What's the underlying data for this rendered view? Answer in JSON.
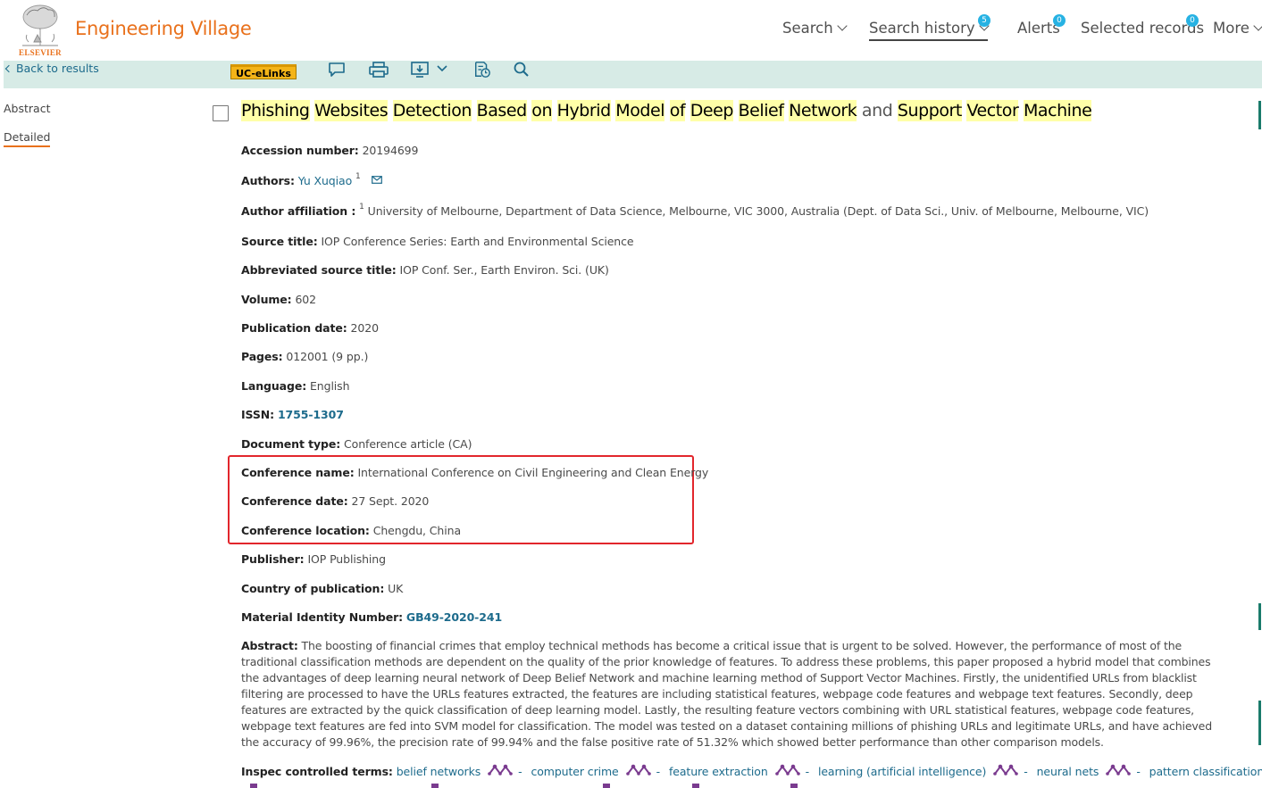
{
  "brand": {
    "logo_text": "ELSEVIER",
    "name": "Engineering Village"
  },
  "topnav": {
    "search": "Search",
    "search_history": "Search history",
    "search_history_badge": "5",
    "alerts": "Alerts",
    "alerts_badge": "0",
    "selected_records": "Selected records",
    "selected_records_badge": "0",
    "more": "More"
  },
  "toolbar": {
    "back_label": "Back to results",
    "uc_elinks": "UC-eLinks",
    "icons": [
      "comment-icon",
      "print-icon",
      "download-icon",
      "folder-save-icon",
      "search-icon"
    ]
  },
  "sidenav": {
    "abstract": "Abstract",
    "detailed": "Detailed"
  },
  "record": {
    "title_words": [
      {
        "text": "Phishing",
        "hl": true
      },
      {
        "text": "Websites",
        "hl": true
      },
      {
        "text": "Detection",
        "hl": true
      },
      {
        "text": "Based",
        "hl": true
      },
      {
        "text": "on",
        "hl": true
      },
      {
        "text": "Hybrid",
        "hl": true
      },
      {
        "text": "Model",
        "hl": true
      },
      {
        "text": "of",
        "hl": true
      },
      {
        "text": "Deep",
        "hl": true
      },
      {
        "text": "Belief",
        "hl": true
      },
      {
        "text": "Network",
        "hl": true
      },
      {
        "text": "and",
        "hl": false
      },
      {
        "text": "Support",
        "hl": true
      },
      {
        "text": "Vector",
        "hl": true
      },
      {
        "text": "Machine",
        "hl": true
      }
    ],
    "accession_label": "Accession number:",
    "accession": "20194699",
    "authors_label": "Authors:",
    "author": "Yu Xuqiao",
    "author_sup": "1",
    "affiliation_label": "Author affiliation :",
    "affiliation_sup": "1",
    "affiliation": "University of Melbourne, Department of Data Science, Melbourne, VIC 3000, Australia (Dept. of Data Sci., Univ. of Melbourne, Melbourne, VIC)",
    "source_label": "Source title:",
    "source": "IOP Conference Series: Earth and Environmental Science",
    "abbr_label": "Abbreviated source title:",
    "abbr": "IOP Conf. Ser., Earth Environ. Sci. (UK)",
    "volume_label": "Volume:",
    "volume": "602",
    "pubdate_label": "Publication date:",
    "pubdate": "2020",
    "pages_label": "Pages:",
    "pages": "012001 (9 pp.)",
    "language_label": "Language:",
    "language": "English",
    "issn_label": "ISSN:",
    "issn": "1755-1307",
    "doctype_label": "Document type:",
    "doctype": "Conference article (CA)",
    "confname_label": "Conference name:",
    "confname": "International Conference on Civil Engineering and Clean Energy",
    "confdate_label": "Conference date:",
    "confdate": "27 Sept. 2020",
    "confloc_label": "Conference location:",
    "confloc": "Chengdu, China",
    "publisher_label": "Publisher:",
    "publisher": "IOP Publishing",
    "country_label": "Country of publication:",
    "country": "UK",
    "material_label": "Material Identity Number:",
    "material": "GB49-2020-241",
    "abstract_label": "Abstract:",
    "abstract": "The boosting of financial crimes that employ technical methods has become a critical issue that is urgent to be solved. However, the performance of most of the traditional classification methods are dependent on the quality of the prior knowledge of features. To address these problems, this paper proposed a hybrid model that combines the advantages of deep learning neural network of Deep Belief Network and machine learning method of Support Vector Machines. Firstly, the unidentified URLs from blacklist filtering are processed to have the URLs features extracted, the features are including statistical features, webpage code features and webpage text features. Secondly, deep features are extracted by the quick classification of deep learning model. Lastly, the resulting feature vectors combining with URL statistical features, webpage code features, webpage text features are fed into SVM model for classification. The model was tested on a dataset containing millions of phishing URLs and legitimate URLs, and have achieved the accuracy of 99.96%, the precision rate of 99.94% and the false positive rate of 51.32% which showed better performance than other comparison models.",
    "inspec_label": "Inspec controlled terms:",
    "inspec_terms": [
      "belief networks",
      "computer crime",
      "feature extraction",
      "learning (artificial intelligence)",
      "neural nets",
      "pattern classification"
    ]
  },
  "colors": {
    "brand": "#e9711c",
    "toolbar_bg": "#d7ebe6",
    "link": "#1d6b8c",
    "highlight": "#ffffa8",
    "badge": "#27b2e3",
    "annotation_box": "#e2262c",
    "tree_icon": "#7a3b8f"
  }
}
